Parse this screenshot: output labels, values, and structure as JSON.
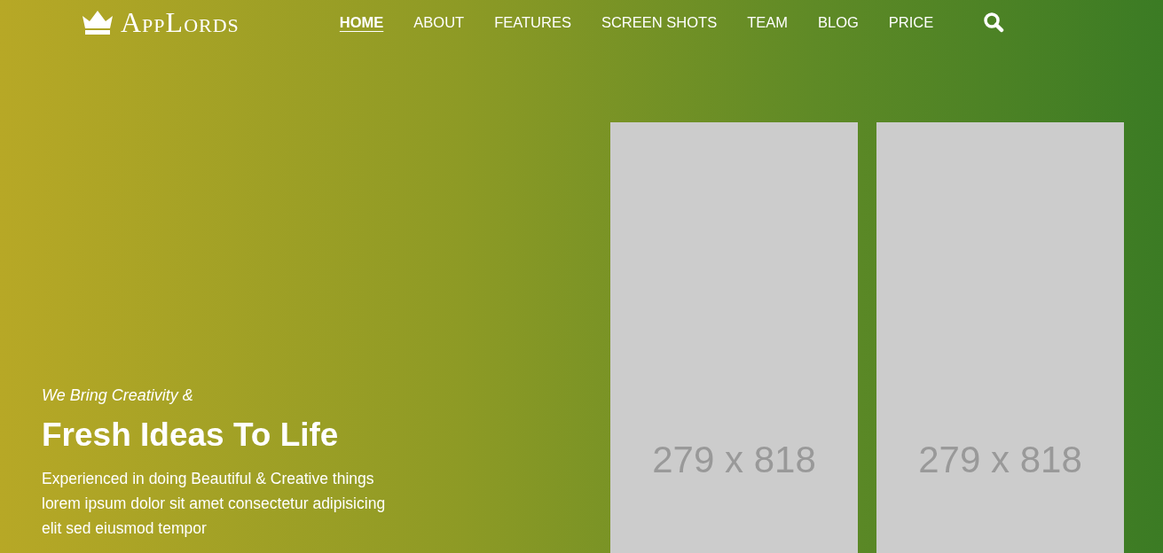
{
  "logo": {
    "text": "AppLords"
  },
  "nav": [
    {
      "label": "HOME",
      "selected": true
    },
    {
      "label": "ABOUT",
      "selected": false
    },
    {
      "label": "FEATURES",
      "selected": false
    },
    {
      "label": "SCREEN SHOTS",
      "selected": false
    },
    {
      "label": "TEAM",
      "selected": false
    },
    {
      "label": "BLOG",
      "selected": false
    },
    {
      "label": "PRICE",
      "selected": false
    }
  ],
  "hero": {
    "subtitle": "We Bring Creativity &",
    "heading": "Fresh Ideas To Life",
    "text": "Experienced in doing Beautiful & Creative things lorem ipsum dolor sit amet consectetur adipisicing elit sed eiusmod tempor"
  },
  "screens": [
    {
      "label": "279 x 818"
    },
    {
      "label": "279 x 818"
    }
  ]
}
